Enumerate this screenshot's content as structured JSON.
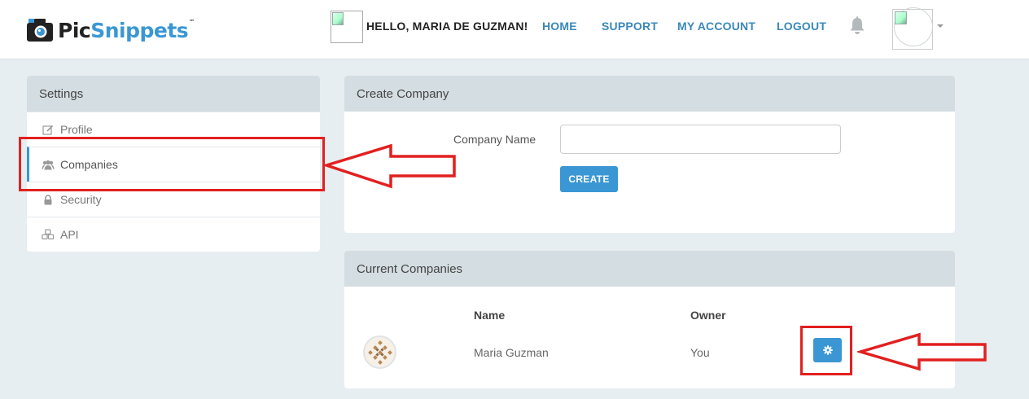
{
  "brand": {
    "logo_part1": "Pic",
    "logo_part2": "Snippets",
    "trademark": "™"
  },
  "header": {
    "greeting": "HELLO, MARIA DE GUZMAN!",
    "nav": [
      "HOME",
      "SUPPORT",
      "MY ACCOUNT",
      "LOGOUT"
    ],
    "icons": [
      "bell-icon",
      "user-avatar",
      "chevron-down-icon"
    ]
  },
  "sidebar": {
    "title": "Settings",
    "items": [
      {
        "label": "Profile",
        "icon": "edit-icon",
        "active": false
      },
      {
        "label": "Companies",
        "icon": "users-icon",
        "active": true
      },
      {
        "label": "Security",
        "icon": "lock-icon",
        "active": false
      },
      {
        "label": "API",
        "icon": "cubes-icon",
        "active": false
      }
    ]
  },
  "create_company": {
    "title": "Create Company",
    "field_label": "Company Name",
    "field_value": "",
    "button": "CREATE"
  },
  "current_companies": {
    "title": "Current Companies",
    "columns": [
      "Name",
      "Owner"
    ],
    "rows": [
      {
        "name": "Maria Guzman",
        "owner": "You",
        "action_icon": "gear-icon"
      }
    ]
  },
  "colors": {
    "accent": "#3a97d4",
    "annotation": "#e1201f",
    "panel_header": "#d4dde1",
    "background": "#e7eef1"
  }
}
